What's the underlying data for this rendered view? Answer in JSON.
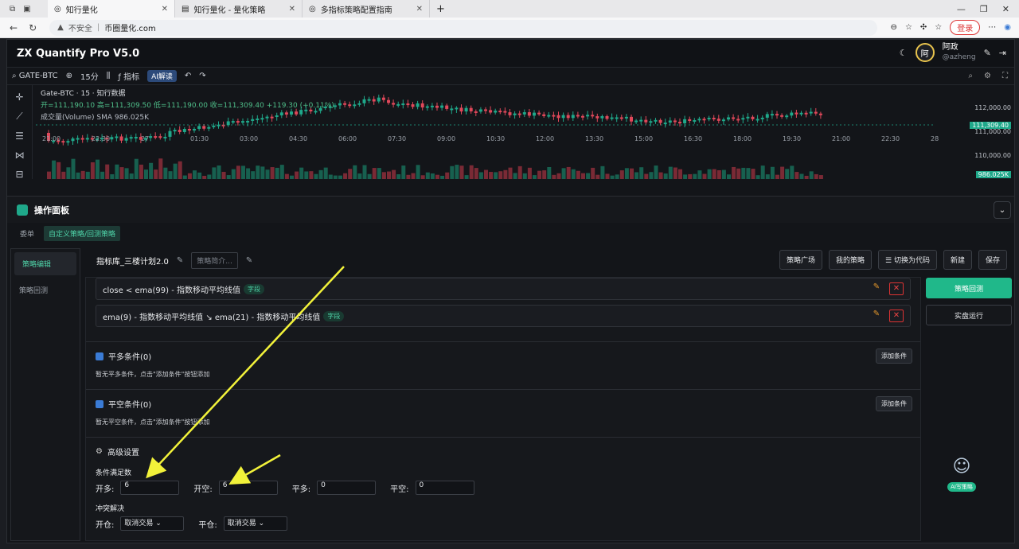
{
  "browser": {
    "tabs": [
      {
        "label": "知行量化",
        "active": true
      },
      {
        "label": "知行量化 - 量化策略",
        "active": false
      },
      {
        "label": "多指标策略配置指南",
        "active": false
      }
    ],
    "address_warning": "不安全",
    "url": "币圈量化.com",
    "login_label": "登录"
  },
  "app": {
    "title": "ZX Quantify Pro V5.0",
    "user": {
      "avatar_text": "阿",
      "name": "阿政",
      "handle": "@azheng"
    }
  },
  "chart_toolbar": {
    "symbol": "GATE-BTC",
    "interval": "15分",
    "indicator_label": "指标",
    "ai_label": "AI解读"
  },
  "chart_legend": {
    "title": "Gate-BTC · 15 · 知行数据",
    "ohlc": "开=111,190.10 高=111,309.50 低=111,190.00 收=111,309.40 +119.30 (+0.11%)",
    "volume": "成交量(Volume) SMA 986.025K"
  },
  "chart_data": {
    "type": "candlestick",
    "price_ticks": [
      "112,000.00",
      "111,000.00",
      "110,000.00"
    ],
    "last_price": "111,309.40",
    "volume_value": "986.025K",
    "time_ticks": [
      "21:00",
      "22:30",
      "27",
      "01:30",
      "03:00",
      "04:30",
      "06:00",
      "07:30",
      "09:00",
      "10:30",
      "12:00",
      "13:30",
      "15:00",
      "16:30",
      "18:00",
      "19:30",
      "21:00",
      "22:30",
      "28"
    ]
  },
  "panel": {
    "title": "操作面板",
    "sub_tabs": [
      "委单",
      "自定义策略/回测策略"
    ],
    "nav": [
      "策略编辑",
      "策略回测"
    ],
    "strategy_name": "指标库_三楼计划2.0",
    "intro_placeholder": "策略简介...",
    "top_buttons": [
      "策略广场",
      "我的策略",
      "切换为代码",
      "新建",
      "保存"
    ],
    "conditions": [
      {
        "text": "close  <  ema(99) - 指数移动平均线值",
        "badge": "字段"
      },
      {
        "text": "ema(9) - 指数移动平均线值  ↘  ema(21) - 指数移动平均线值",
        "badge": "字段"
      }
    ],
    "sections": [
      {
        "title": "平多条件(0)",
        "hint": "暂无平多条件，点击\"添加条件\"按钮添加",
        "add": "添加条件"
      },
      {
        "title": "平空条件(0)",
        "hint": "暂无平空条件，点击\"添加条件\"按钮添加",
        "add": "添加条件"
      }
    ],
    "advanced": {
      "title": "高级设置",
      "cond_label": "条件满足数",
      "fields": [
        {
          "label": "开多:",
          "value": "6"
        },
        {
          "label": "开空:",
          "value": "6"
        },
        {
          "label": "平多:",
          "value": "0"
        },
        {
          "label": "平空:",
          "value": "0"
        }
      ],
      "conflict_label": "冲突解决",
      "selects": [
        {
          "label": "开仓:",
          "value": "取消交易"
        },
        {
          "label": "平仓:",
          "value": "取消交易"
        }
      ]
    },
    "backtest_button": "策略回测",
    "live_button": "实盘运行",
    "ai_strategy_label": "AI写策略"
  },
  "colors": {
    "accent": "#20b88a",
    "up": "#1fa88a",
    "down": "#e0485a",
    "arrow": "#f2f23a"
  }
}
